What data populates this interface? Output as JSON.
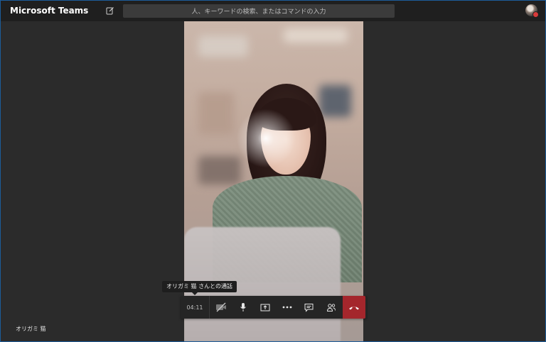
{
  "app": {
    "title": "Microsoft Teams"
  },
  "search": {
    "placeholder": "人、キーワードの検索、またはコマンドの入力"
  },
  "call": {
    "tooltip": "オリガミ 猫 さんとの通話",
    "timer": "04:11",
    "controls": [
      {
        "name": "camera-off",
        "label": "camera"
      },
      {
        "name": "microphone",
        "label": "mic"
      },
      {
        "name": "share-screen",
        "label": "share"
      },
      {
        "name": "more-options",
        "label": "more"
      },
      {
        "name": "chat",
        "label": "chat"
      },
      {
        "name": "participants",
        "label": "people"
      },
      {
        "name": "hang-up",
        "label": "end"
      }
    ]
  },
  "participant": {
    "name": "オリガミ 猫"
  },
  "colors": {
    "accent_hangup": "#a4262c",
    "presence_busy": "#d83b3b",
    "titlebar": "#1f1f1f",
    "stage": "#2b2b2b"
  }
}
